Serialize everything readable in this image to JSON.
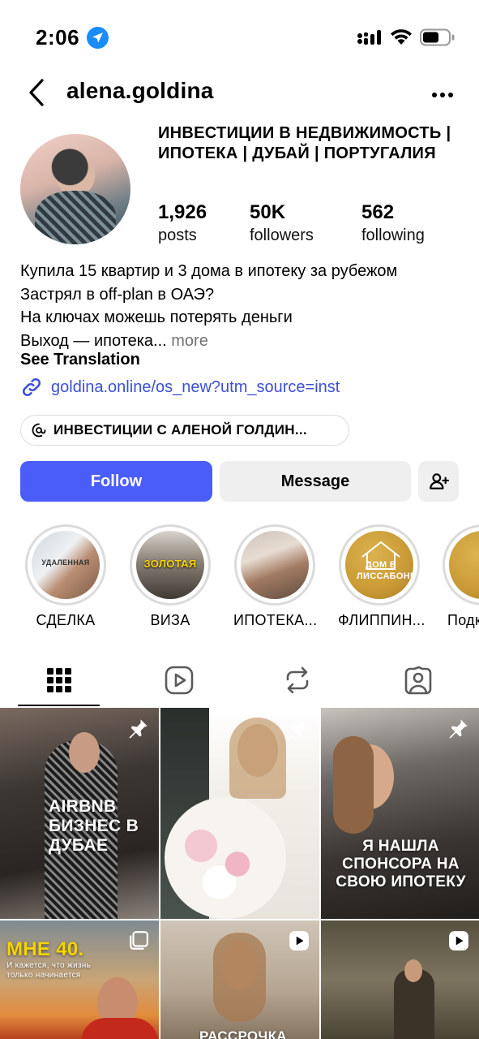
{
  "status_bar": {
    "time": "2:06"
  },
  "header": {
    "username": "alena.goldina"
  },
  "profile": {
    "category_title": "ИНВЕСТИЦИИ В НЕДВИЖИМОСТЬ | ИПОТЕКА | ДУБАЙ | ПОРТУГАЛИЯ",
    "stats": [
      {
        "value": "1,926",
        "label": "posts"
      },
      {
        "value": "50K",
        "label": "followers"
      },
      {
        "value": "562",
        "label": "following"
      }
    ],
    "bio_lines": [
      "Купила 15 квартир и 3 дома в ипотеку за рубежом",
      "Застрял в off-plan в ОАЭ?",
      "На ключах можешь потерять деньги",
      "Выход — ипотека..."
    ],
    "more_label": "more",
    "see_translation": "See Translation",
    "link": "goldina.online/os_new?utm_source=inst",
    "thread_chip": "ИНВЕСТИЦИИ С АЛЕНОЙ ГОЛДИН..."
  },
  "actions": {
    "follow": "Follow",
    "message": "Message"
  },
  "highlights": [
    {
      "label": "СДЕЛКА",
      "caption": "УДАЛЕННАЯ"
    },
    {
      "label": "ВИЗА",
      "caption": "ЗОЛОТАЯ"
    },
    {
      "label": "ИПОТЕКА...",
      "caption": ""
    },
    {
      "label": "ФЛИППИН...",
      "caption": "ДОМ В ЛИССАБОНЕ"
    },
    {
      "label": "Подк",
      "caption": ""
    }
  ],
  "grid": [
    {
      "text": "AIRBNB БИЗНЕС В ДУБАЕ",
      "badge": "pin"
    },
    {
      "text": "",
      "badge": "pin"
    },
    {
      "text": "Я НАШЛА СПОНСОРА НА СВОЮ ИПОТЕКУ",
      "badge": "pin"
    },
    {
      "text": "МНЕ 40.",
      "subtext": "И кажется, что жизнь только начинается",
      "badge": "carousel"
    },
    {
      "text": "РАССРОЧКА",
      "badge": "reel"
    },
    {
      "text": "",
      "badge": "reel"
    }
  ],
  "colors": {
    "follow": "#4a5df9",
    "link": "#3b51d4",
    "secondary_button": "#efefef",
    "location": "#1a8cff"
  }
}
